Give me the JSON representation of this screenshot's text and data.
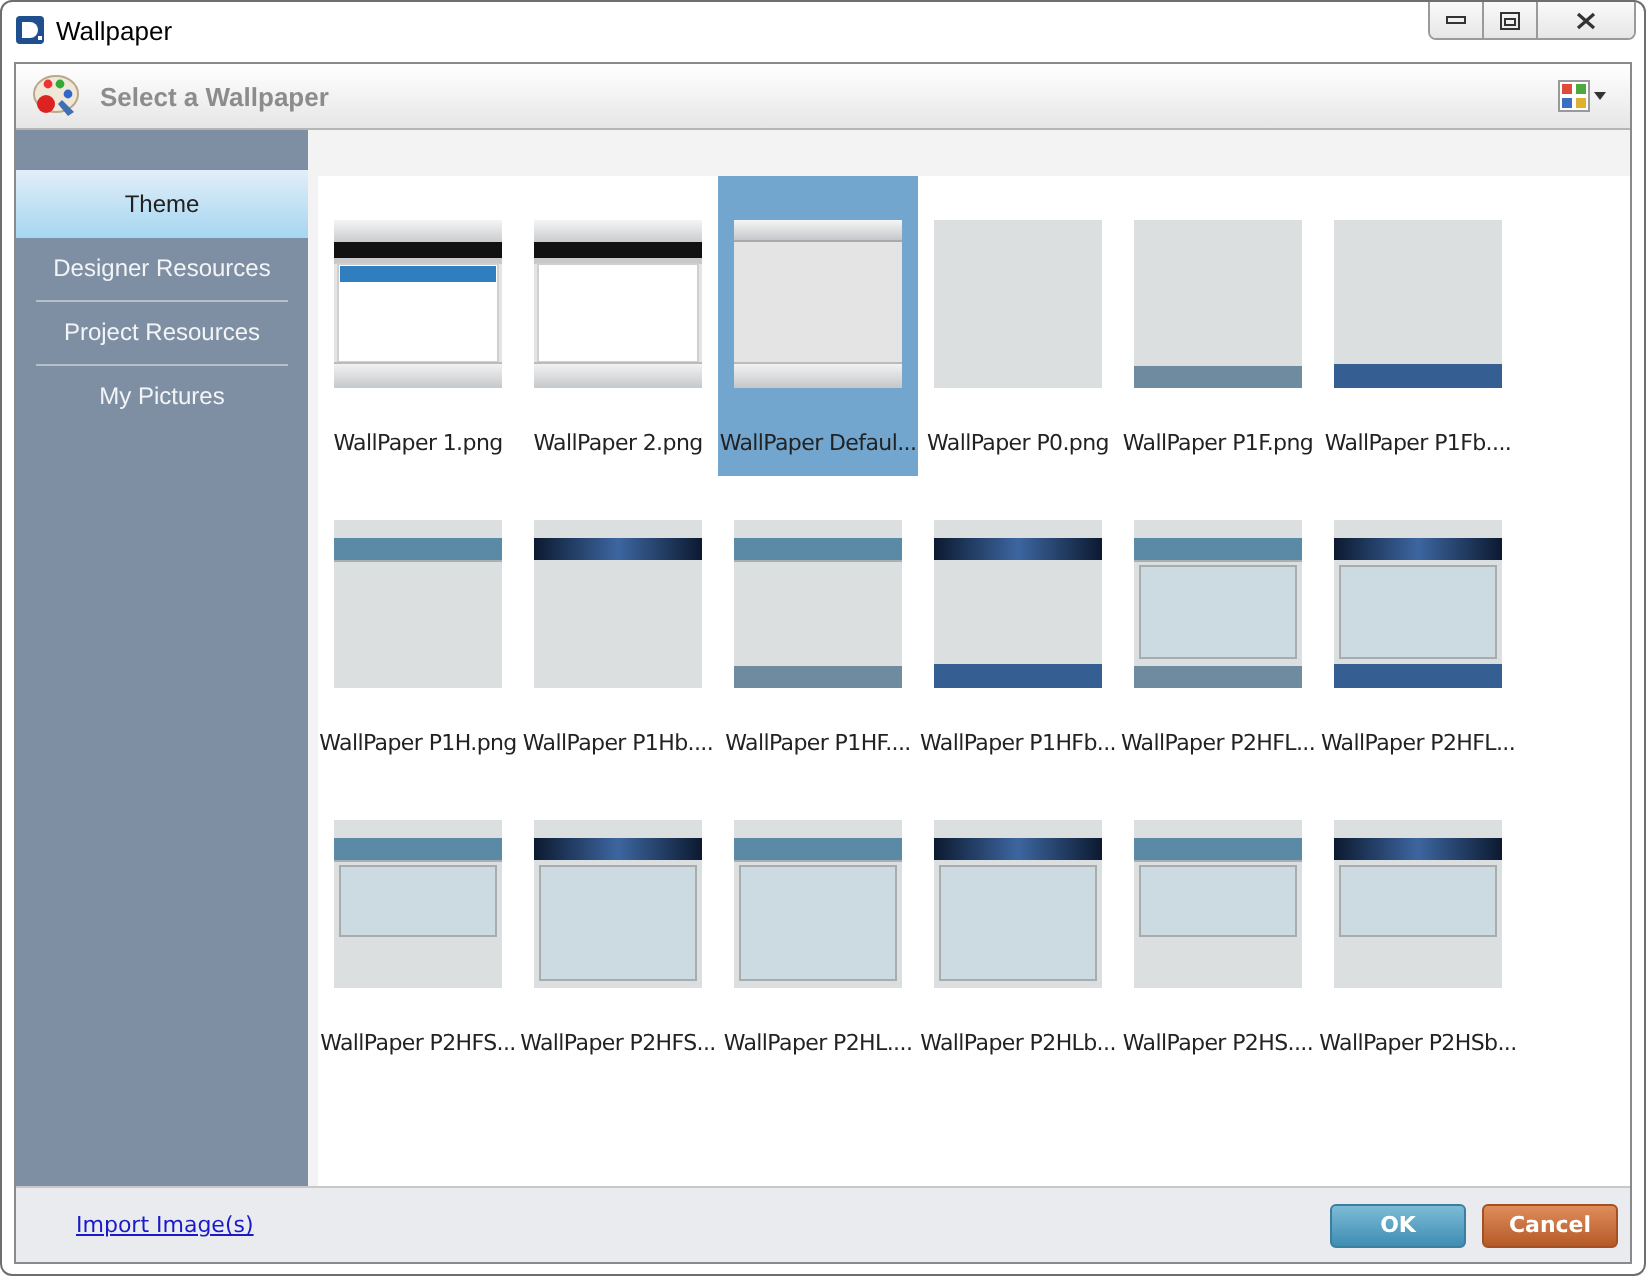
{
  "window": {
    "title": "Wallpaper"
  },
  "header": {
    "title": "Select a Wallpaper"
  },
  "sidebar": {
    "items": [
      {
        "label": "Theme",
        "selected": true
      },
      {
        "label": "Designer Resources",
        "selected": false
      },
      {
        "label": "Project Resources",
        "selected": false
      },
      {
        "label": "My Pictures",
        "selected": false
      }
    ]
  },
  "items": [
    {
      "label": "WallPaper 1.png",
      "selected": false,
      "kind": "classic"
    },
    {
      "label": "WallPaper 2.png",
      "selected": false,
      "kind": "classicplain"
    },
    {
      "label": "WallPaper Defaul...",
      "selected": true,
      "kind": "silver"
    },
    {
      "label": "WallPaper P0.png",
      "selected": false,
      "kind": "plain"
    },
    {
      "label": "WallPaper P1F.png",
      "selected": false,
      "kind": "footer"
    },
    {
      "label": "WallPaper P1Fb....",
      "selected": false,
      "kind": "footerblue"
    },
    {
      "label": "WallPaper P1H.png",
      "selected": false,
      "kind": "header"
    },
    {
      "label": "WallPaper P1Hb....",
      "selected": false,
      "kind": "headerblue"
    },
    {
      "label": "WallPaper P1HF....",
      "selected": false,
      "kind": "headerfooter"
    },
    {
      "label": "WallPaper P1HFb...",
      "selected": false,
      "kind": "headerfooterblue"
    },
    {
      "label": "WallPaper P2HFL...",
      "selected": false,
      "kind": "framed"
    },
    {
      "label": "WallPaper P2HFL...",
      "selected": false,
      "kind": "framedblue"
    },
    {
      "label": "WallPaper P2HFS...",
      "selected": false,
      "kind": "panel"
    },
    {
      "label": "WallPaper P2HFS...",
      "selected": false,
      "kind": "tallblue"
    },
    {
      "label": "WallPaper P2HL....",
      "selected": false,
      "kind": "tall"
    },
    {
      "label": "WallPaper P2HLb...",
      "selected": false,
      "kind": "tallblue"
    },
    {
      "label": "WallPaper P2HS....",
      "selected": false,
      "kind": "panel"
    },
    {
      "label": "WallPaper P2HSb...",
      "selected": false,
      "kind": "panelblue"
    }
  ],
  "footer": {
    "link": "Import Image(s)",
    "buttons": [
      {
        "label": "OK",
        "kind": "primary"
      },
      {
        "label": "Cancel",
        "kind": "cancel"
      }
    ]
  }
}
